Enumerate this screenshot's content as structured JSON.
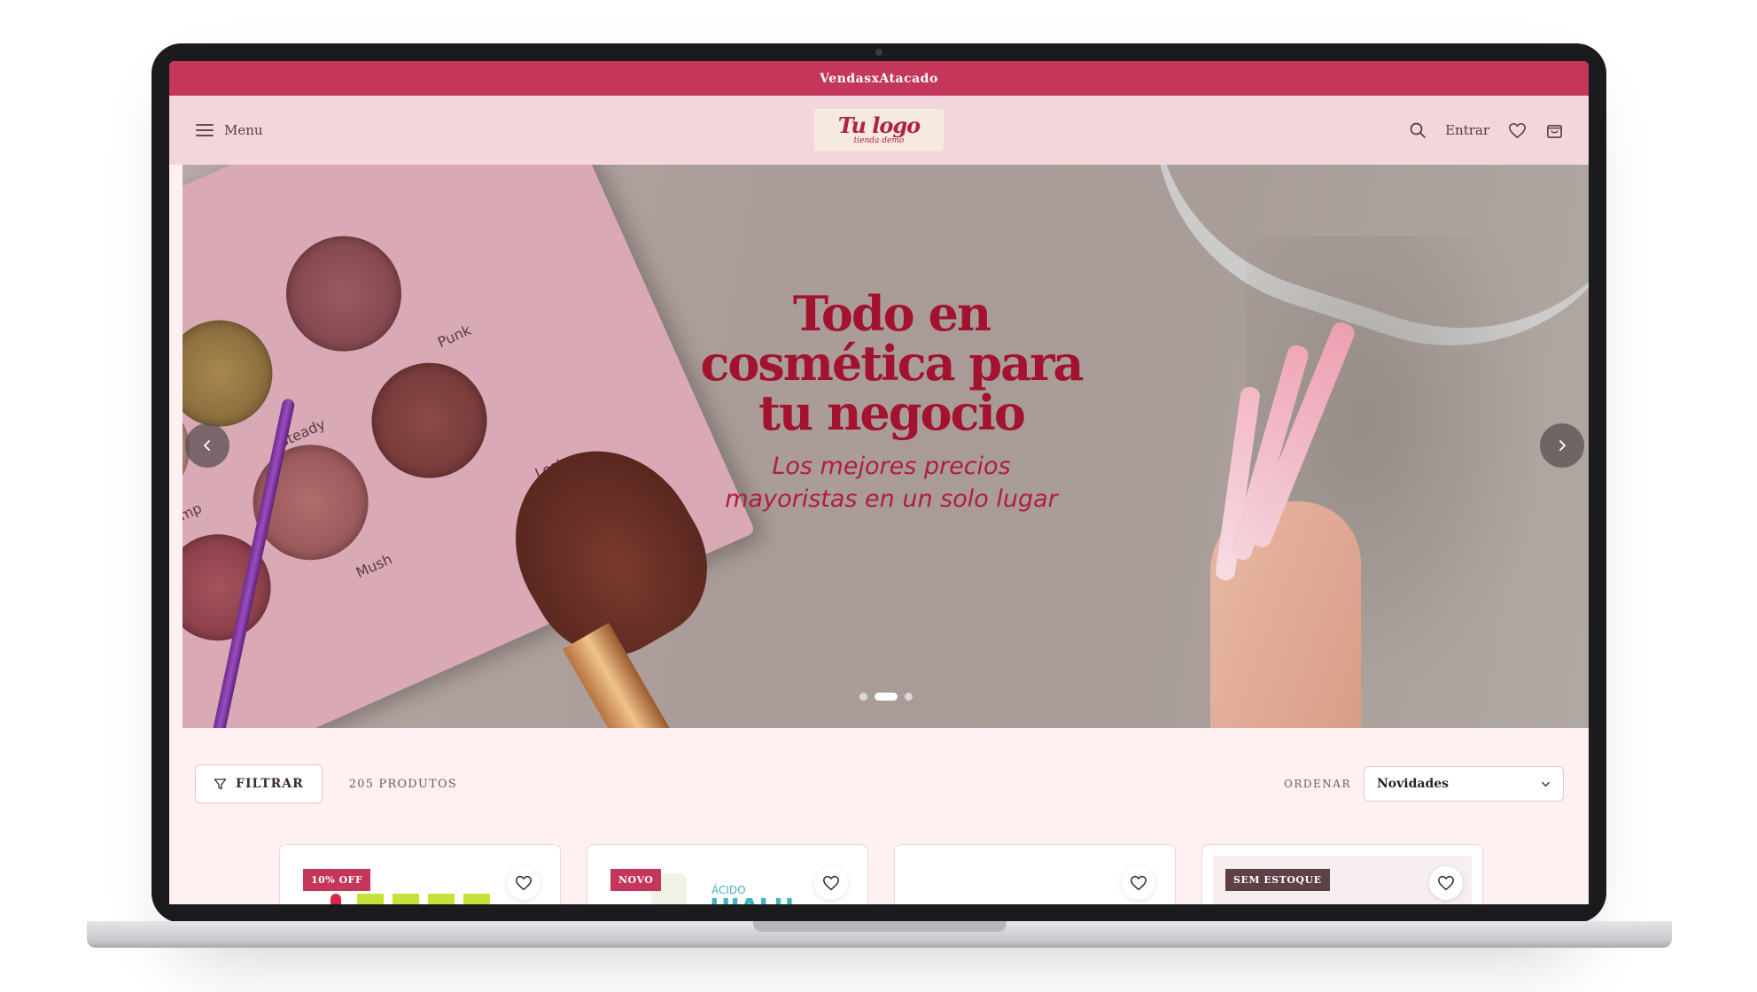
{
  "store": {
    "announcement": "VendasxAtacado",
    "logo_main": "Tu logo",
    "logo_sub": "tienda demo"
  },
  "header": {
    "menu_label": "Menu",
    "login_label": "Entrar",
    "icons": [
      "menu-icon",
      "search-icon",
      "heart-icon",
      "bag-icon"
    ]
  },
  "hero": {
    "title_line1": "Todo en",
    "title_line2": "cosmética para",
    "title_line3": "tu negocio",
    "subtitle_line1": "Los mejores precios",
    "subtitle_line2": "mayoristas en un solo lugar",
    "palette_labels": [
      "Punk",
      "Steady",
      "Skimp",
      "Lost",
      "Mush"
    ],
    "active_slide": 2,
    "slide_count": 3
  },
  "toolbar": {
    "filter_label": "FILTRAR",
    "product_count": "205 PRODUTOS",
    "sort_label": "ORDENAR",
    "sort_value": "Novidades"
  },
  "products": [
    {
      "badge": "10% OFF",
      "badge_type": "sale"
    },
    {
      "badge": "NOVO",
      "badge_type": "new",
      "partial_text_top": "ÁCIDO",
      "partial_text_bottom": "HIALU"
    },
    {
      "badge": "",
      "badge_type": ""
    },
    {
      "badge": "SEM ESTOQUE",
      "badge_type": "out"
    }
  ],
  "colors": {
    "accent": "#c4365a",
    "header_bg": "#f3d5dc",
    "page_bg": "#fff0f2",
    "hero_title": "#a3122f"
  }
}
